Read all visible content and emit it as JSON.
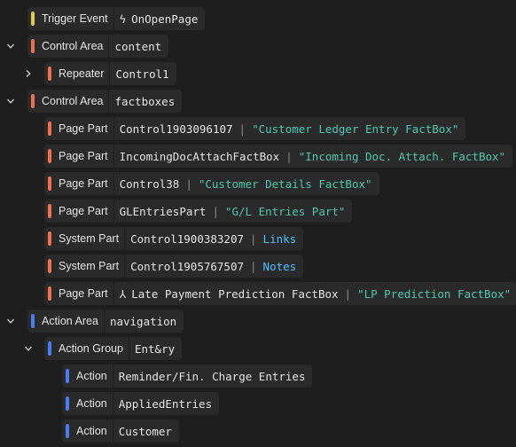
{
  "colors": {
    "trigger": "#e3c84a",
    "control": "#ee7252",
    "action": "#4c7df0"
  },
  "rows": [
    {
      "kind": "Trigger Event",
      "name": "OnOpenPage",
      "glyph": "ϟ"
    },
    {
      "kind": "Control Area",
      "name": "content"
    },
    {
      "kind": "Repeater",
      "name": "Control1"
    },
    {
      "kind": "Control Area",
      "name": "factboxes"
    },
    {
      "kind": "Page Part",
      "name": "Control1903096107",
      "caption": "\"Customer Ledger Entry FactBox\""
    },
    {
      "kind": "Page Part",
      "name": "IncomingDocAttachFactBox",
      "caption": "\"Incoming Doc. Attach. FactBox\""
    },
    {
      "kind": "Page Part",
      "name": "Control38",
      "caption": "\"Customer Details FactBox\""
    },
    {
      "kind": "Page Part",
      "name": "GLEntriesPart",
      "caption": "\"G/L Entries Part\""
    },
    {
      "kind": "System Part",
      "name": "Control1900383207",
      "link": "Links"
    },
    {
      "kind": "System Part",
      "name": "Control1905767507",
      "link": "Notes"
    },
    {
      "kind": "Page Part",
      "name": "Late Payment Prediction FactBox",
      "caption": "\"LP Prediction FactBox\"",
      "glyph": "⅄"
    },
    {
      "kind": "Action Area",
      "name": "navigation"
    },
    {
      "kind": "Action Group",
      "name": "Ent&ry"
    },
    {
      "kind": "Action",
      "name": "Reminder/Fin. Charge Entries"
    },
    {
      "kind": "Action",
      "name": "AppliedEntries"
    },
    {
      "kind": "Action",
      "name": "Customer"
    }
  ]
}
